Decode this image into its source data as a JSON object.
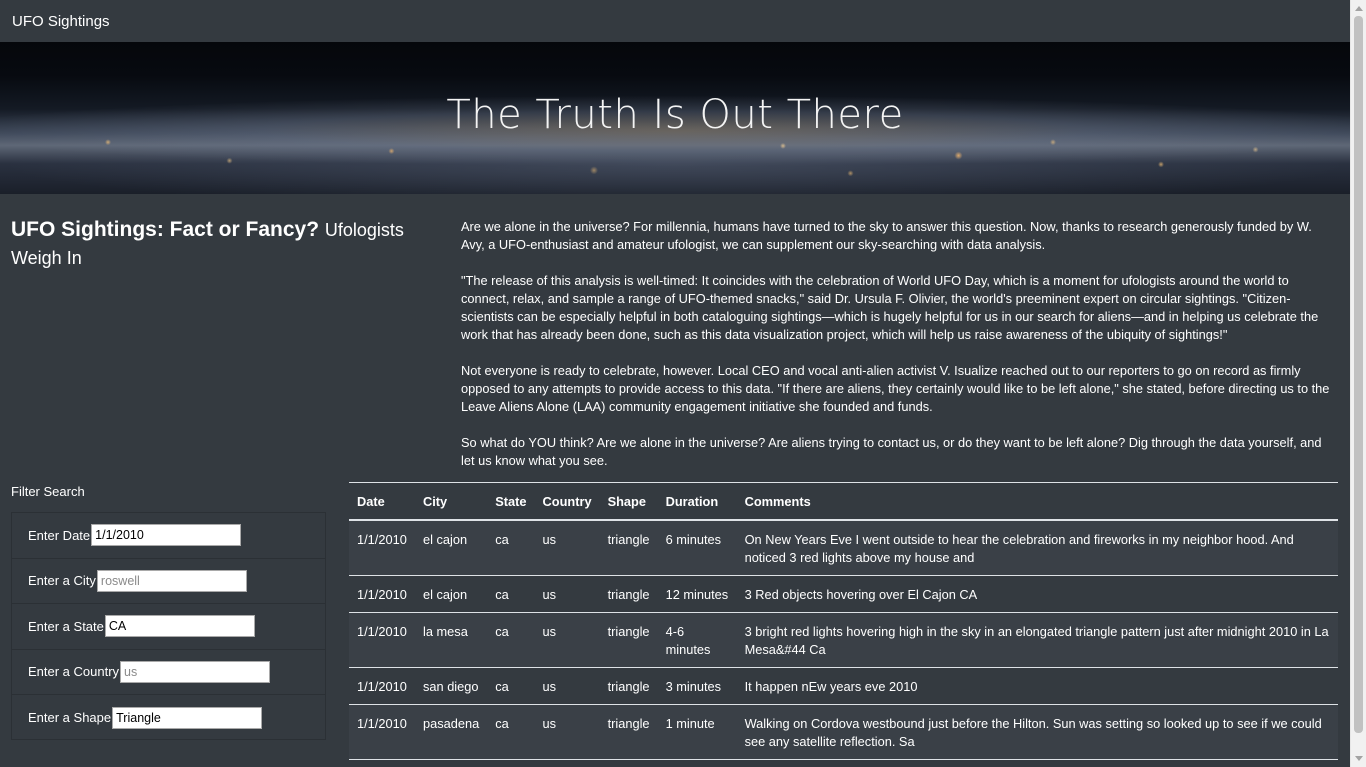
{
  "navbar": {
    "brand": "UFO Sightings"
  },
  "hero": {
    "title": "The Truth Is Out There"
  },
  "intro": {
    "heading": "UFO Sightings: Fact or Fancy?",
    "subheading": "Ufologists Weigh In"
  },
  "article": {
    "paragraphs": [
      "Are we alone in the universe? For millennia, humans have turned to the sky to answer this question. Now, thanks to research generously funded by W. Avy, a UFO-enthusiast and amateur ufologist, we can supplement our sky-searching with data analysis.",
      "\"The release of this analysis is well-timed: It coincides with the celebration of World UFO Day, which is a moment for ufologists around the world to connect, relax, and sample a range of UFO-themed snacks,\" said Dr. Ursula F. Olivier, the world's preeminent expert on circular sightings. \"Citizen-scientists can be especially helpful in both cataloguing sightings—which is hugely helpful for us in our search for aliens—and in helping us celebrate the work that has already been done, such as this data visualization project, which will help us raise awareness of the ubiquity of sightings!\"",
      "Not everyone is ready to celebrate, however. Local CEO and vocal anti-alien activist V. Isualize reached out to our reporters to go on record as firmly opposed to any attempts to provide access to this data. \"If there are aliens, they certainly would like to be left alone,\" she stated, before directing us to the Leave Aliens Alone (LAA) community engagement initiative she founded and funds.",
      "So what do YOU think? Are we alone in the universe? Are aliens trying to contact us, or do they want to be left alone? Dig through the data yourself, and let us know what you see."
    ]
  },
  "filters": {
    "title": "Filter Search",
    "date": {
      "label": "Enter Date",
      "value": "1/1/2010",
      "placeholder": ""
    },
    "city": {
      "label": "Enter a City",
      "value": "",
      "placeholder": "roswell"
    },
    "state": {
      "label": "Enter a State",
      "value": "CA",
      "placeholder": ""
    },
    "country": {
      "label": "Enter a Country",
      "value": "",
      "placeholder": "us"
    },
    "shape": {
      "label": "Enter a Shape",
      "value": "Triangle",
      "placeholder": ""
    }
  },
  "table": {
    "headers": [
      "Date",
      "City",
      "State",
      "Country",
      "Shape",
      "Duration",
      "Comments"
    ],
    "rows": [
      [
        "1/1/2010",
        "el cajon",
        "ca",
        "us",
        "triangle",
        "6 minutes",
        "On New Years Eve I went outside to hear the celebration and fireworks in my neighbor hood. And noticed 3 red lights above my house and"
      ],
      [
        "1/1/2010",
        "el cajon",
        "ca",
        "us",
        "triangle",
        "12 minutes",
        "3 Red objects hovering over El Cajon CA"
      ],
      [
        "1/1/2010",
        "la mesa",
        "ca",
        "us",
        "triangle",
        "4-6 minutes",
        "3 bright red lights hovering high in the sky in an elongated triangle pattern just after midnight 2010 in La Mesa&#44 Ca"
      ],
      [
        "1/1/2010",
        "san diego",
        "ca",
        "us",
        "triangle",
        "3 minutes",
        "It happen nEw years eve 2010"
      ],
      [
        "1/1/2010",
        "pasadena",
        "ca",
        "us",
        "triangle",
        "1 minute",
        "Walking on Cordova westbound just before the Hilton. Sun was setting so looked up to see if we could see any satellite reflection. Sa"
      ]
    ]
  }
}
